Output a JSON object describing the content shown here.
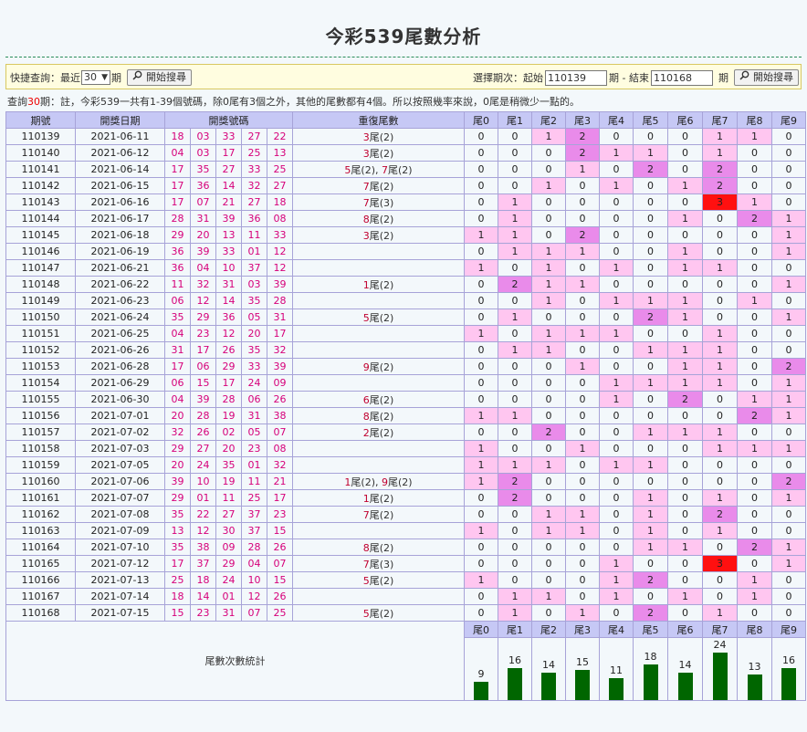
{
  "title": "今彩539尾數分析",
  "query": {
    "quick_label": "快捷查詢：最近",
    "recent_value": "30",
    "period_unit": "期",
    "search_button": "開始搜尋",
    "range_label": "選擇期次：起始",
    "start_value": "110139",
    "range_mid": "期 - 結束",
    "end_value": "110168",
    "range_unit": "期",
    "search_button_2": "開始搜尋"
  },
  "note": {
    "prefix": "查詢",
    "count": "30",
    "rest": "期：註，今彩539一共有1-39個號碼，除0尾有3個之外，其他的尾數都有4個。所以按照幾率來說，0尾是稍微少一點的。"
  },
  "headers": [
    "期號",
    "開獎日期",
    "開獎號碼",
    "重復尾數",
    "尾0",
    "尾1",
    "尾2",
    "尾3",
    "尾4",
    "尾5",
    "尾6",
    "尾7",
    "尾8",
    "尾9"
  ],
  "rows": [
    {
      "period": "110139",
      "date": "2021-06-11",
      "nums": [
        "18",
        "03",
        "33",
        "27",
        "22"
      ],
      "dup": [
        {
          "d": "3",
          "c": "(2)"
        }
      ],
      "tails": [
        0,
        0,
        1,
        2,
        0,
        0,
        0,
        1,
        1,
        0
      ]
    },
    {
      "period": "110140",
      "date": "2021-06-12",
      "nums": [
        "04",
        "03",
        "17",
        "25",
        "13"
      ],
      "dup": [
        {
          "d": "3",
          "c": "(2)"
        }
      ],
      "tails": [
        0,
        0,
        0,
        2,
        1,
        1,
        0,
        1,
        0,
        0
      ]
    },
    {
      "period": "110141",
      "date": "2021-06-14",
      "nums": [
        "17",
        "35",
        "27",
        "33",
        "25"
      ],
      "dup": [
        {
          "d": "5",
          "c": "(2)"
        },
        {
          "d": "7",
          "c": "(2)"
        }
      ],
      "tails": [
        0,
        0,
        0,
        1,
        0,
        2,
        0,
        2,
        0,
        0
      ]
    },
    {
      "period": "110142",
      "date": "2021-06-15",
      "nums": [
        "17",
        "36",
        "14",
        "32",
        "27"
      ],
      "dup": [
        {
          "d": "7",
          "c": "(2)"
        }
      ],
      "tails": [
        0,
        0,
        1,
        0,
        1,
        0,
        1,
        2,
        0,
        0
      ]
    },
    {
      "period": "110143",
      "date": "2021-06-16",
      "nums": [
        "17",
        "07",
        "21",
        "27",
        "18"
      ],
      "dup": [
        {
          "d": "7",
          "c": "(3)"
        }
      ],
      "tails": [
        0,
        1,
        0,
        0,
        0,
        0,
        0,
        3,
        1,
        0
      ]
    },
    {
      "period": "110144",
      "date": "2021-06-17",
      "nums": [
        "28",
        "31",
        "39",
        "36",
        "08"
      ],
      "dup": [
        {
          "d": "8",
          "c": "(2)"
        }
      ],
      "tails": [
        0,
        1,
        0,
        0,
        0,
        0,
        1,
        0,
        2,
        1
      ]
    },
    {
      "period": "110145",
      "date": "2021-06-18",
      "nums": [
        "29",
        "20",
        "13",
        "11",
        "33"
      ],
      "dup": [
        {
          "d": "3",
          "c": "(2)"
        }
      ],
      "tails": [
        1,
        1,
        0,
        2,
        0,
        0,
        0,
        0,
        0,
        1
      ]
    },
    {
      "period": "110146",
      "date": "2021-06-19",
      "nums": [
        "36",
        "39",
        "33",
        "01",
        "12"
      ],
      "dup": [],
      "tails": [
        0,
        1,
        1,
        1,
        0,
        0,
        1,
        0,
        0,
        1
      ]
    },
    {
      "period": "110147",
      "date": "2021-06-21",
      "nums": [
        "36",
        "04",
        "10",
        "37",
        "12"
      ],
      "dup": [],
      "tails": [
        1,
        0,
        1,
        0,
        1,
        0,
        1,
        1,
        0,
        0
      ]
    },
    {
      "period": "110148",
      "date": "2021-06-22",
      "nums": [
        "11",
        "32",
        "31",
        "03",
        "39"
      ],
      "dup": [
        {
          "d": "1",
          "c": "(2)"
        }
      ],
      "tails": [
        0,
        2,
        1,
        1,
        0,
        0,
        0,
        0,
        0,
        1
      ]
    },
    {
      "period": "110149",
      "date": "2021-06-23",
      "nums": [
        "06",
        "12",
        "14",
        "35",
        "28"
      ],
      "dup": [],
      "tails": [
        0,
        0,
        1,
        0,
        1,
        1,
        1,
        0,
        1,
        0
      ]
    },
    {
      "period": "110150",
      "date": "2021-06-24",
      "nums": [
        "35",
        "29",
        "36",
        "05",
        "31"
      ],
      "dup": [
        {
          "d": "5",
          "c": "(2)"
        }
      ],
      "tails": [
        0,
        1,
        0,
        0,
        0,
        2,
        1,
        0,
        0,
        1
      ]
    },
    {
      "period": "110151",
      "date": "2021-06-25",
      "nums": [
        "04",
        "23",
        "12",
        "20",
        "17"
      ],
      "dup": [],
      "tails": [
        1,
        0,
        1,
        1,
        1,
        0,
        0,
        1,
        0,
        0
      ]
    },
    {
      "period": "110152",
      "date": "2021-06-26",
      "nums": [
        "31",
        "17",
        "26",
        "35",
        "32"
      ],
      "dup": [],
      "tails": [
        0,
        1,
        1,
        0,
        0,
        1,
        1,
        1,
        0,
        0
      ]
    },
    {
      "period": "110153",
      "date": "2021-06-28",
      "nums": [
        "17",
        "06",
        "29",
        "33",
        "39"
      ],
      "dup": [
        {
          "d": "9",
          "c": "(2)"
        }
      ],
      "tails": [
        0,
        0,
        0,
        1,
        0,
        0,
        1,
        1,
        0,
        2
      ]
    },
    {
      "period": "110154",
      "date": "2021-06-29",
      "nums": [
        "06",
        "15",
        "17",
        "24",
        "09"
      ],
      "dup": [],
      "tails": [
        0,
        0,
        0,
        0,
        1,
        1,
        1,
        1,
        0,
        1
      ]
    },
    {
      "period": "110155",
      "date": "2021-06-30",
      "nums": [
        "04",
        "39",
        "28",
        "06",
        "26"
      ],
      "dup": [
        {
          "d": "6",
          "c": "(2)"
        }
      ],
      "tails": [
        0,
        0,
        0,
        0,
        1,
        0,
        2,
        0,
        1,
        1
      ]
    },
    {
      "period": "110156",
      "date": "2021-07-01",
      "nums": [
        "20",
        "28",
        "19",
        "31",
        "38"
      ],
      "dup": [
        {
          "d": "8",
          "c": "(2)"
        }
      ],
      "tails": [
        1,
        1,
        0,
        0,
        0,
        0,
        0,
        0,
        2,
        1
      ]
    },
    {
      "period": "110157",
      "date": "2021-07-02",
      "nums": [
        "32",
        "26",
        "02",
        "05",
        "07"
      ],
      "dup": [
        {
          "d": "2",
          "c": "(2)"
        }
      ],
      "tails": [
        0,
        0,
        2,
        0,
        0,
        1,
        1,
        1,
        0,
        0
      ]
    },
    {
      "period": "110158",
      "date": "2021-07-03",
      "nums": [
        "29",
        "27",
        "20",
        "23",
        "08"
      ],
      "dup": [],
      "tails": [
        1,
        0,
        0,
        1,
        0,
        0,
        0,
        1,
        1,
        1
      ]
    },
    {
      "period": "110159",
      "date": "2021-07-05",
      "nums": [
        "20",
        "24",
        "35",
        "01",
        "32"
      ],
      "dup": [],
      "tails": [
        1,
        1,
        1,
        0,
        1,
        1,
        0,
        0,
        0,
        0
      ]
    },
    {
      "period": "110160",
      "date": "2021-07-06",
      "nums": [
        "39",
        "10",
        "19",
        "11",
        "21"
      ],
      "dup": [
        {
          "d": "1",
          "c": "(2)"
        },
        {
          "d": "9",
          "c": "(2)"
        }
      ],
      "tails": [
        1,
        2,
        0,
        0,
        0,
        0,
        0,
        0,
        0,
        2
      ]
    },
    {
      "period": "110161",
      "date": "2021-07-07",
      "nums": [
        "29",
        "01",
        "11",
        "25",
        "17"
      ],
      "dup": [
        {
          "d": "1",
          "c": "(2)"
        }
      ],
      "tails": [
        0,
        2,
        0,
        0,
        0,
        1,
        0,
        1,
        0,
        1
      ]
    },
    {
      "period": "110162",
      "date": "2021-07-08",
      "nums": [
        "35",
        "22",
        "27",
        "37",
        "23"
      ],
      "dup": [
        {
          "d": "7",
          "c": "(2)"
        }
      ],
      "tails": [
        0,
        0,
        1,
        1,
        0,
        1,
        0,
        2,
        0,
        0
      ]
    },
    {
      "period": "110163",
      "date": "2021-07-09",
      "nums": [
        "13",
        "12",
        "30",
        "37",
        "15"
      ],
      "dup": [],
      "tails": [
        1,
        0,
        1,
        1,
        0,
        1,
        0,
        1,
        0,
        0
      ]
    },
    {
      "period": "110164",
      "date": "2021-07-10",
      "nums": [
        "35",
        "38",
        "09",
        "28",
        "26"
      ],
      "dup": [
        {
          "d": "8",
          "c": "(2)"
        }
      ],
      "tails": [
        0,
        0,
        0,
        0,
        0,
        1,
        1,
        0,
        2,
        1
      ]
    },
    {
      "period": "110165",
      "date": "2021-07-12",
      "nums": [
        "17",
        "37",
        "29",
        "04",
        "07"
      ],
      "dup": [
        {
          "d": "7",
          "c": "(3)"
        }
      ],
      "tails": [
        0,
        0,
        0,
        0,
        1,
        0,
        0,
        3,
        0,
        1
      ]
    },
    {
      "period": "110166",
      "date": "2021-07-13",
      "nums": [
        "25",
        "18",
        "24",
        "10",
        "15"
      ],
      "dup": [
        {
          "d": "5",
          "c": "(2)"
        }
      ],
      "tails": [
        1,
        0,
        0,
        0,
        1,
        2,
        0,
        0,
        1,
        0
      ]
    },
    {
      "period": "110167",
      "date": "2021-07-14",
      "nums": [
        "18",
        "14",
        "01",
        "12",
        "26"
      ],
      "dup": [],
      "tails": [
        0,
        1,
        1,
        0,
        1,
        0,
        1,
        0,
        1,
        0
      ]
    },
    {
      "period": "110168",
      "date": "2021-07-15",
      "nums": [
        "15",
        "23",
        "31",
        "07",
        "25"
      ],
      "dup": [
        {
          "d": "5",
          "c": "(2)"
        }
      ],
      "tails": [
        0,
        1,
        0,
        1,
        0,
        2,
        0,
        1,
        0,
        0
      ]
    }
  ],
  "dup_unit": "尾",
  "summary": {
    "label": "尾數次數統計",
    "tail_labels": [
      "尾0",
      "尾1",
      "尾2",
      "尾3",
      "尾4",
      "尾5",
      "尾6",
      "尾7",
      "尾8",
      "尾9"
    ],
    "counts": [
      9,
      16,
      14,
      15,
      11,
      18,
      14,
      24,
      13,
      16
    ]
  },
  "colors": {
    "header_bg": "#c6c8f5",
    "tail1": "#ffc6f0",
    "tail2": "#e98bea",
    "tail3": "#ff1010",
    "bar": "#006600",
    "number": "#d6007a"
  }
}
